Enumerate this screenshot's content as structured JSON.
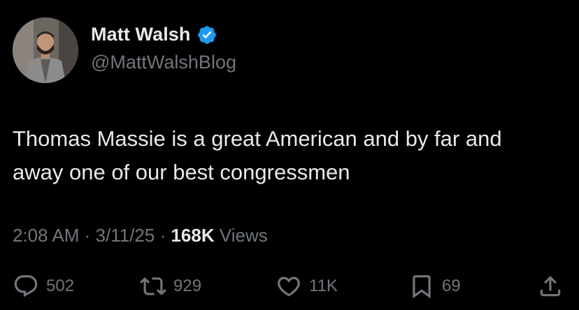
{
  "author": {
    "display_name": "Matt Walsh",
    "handle": "@MattWalshBlog",
    "verified_color": "#1d9bf0"
  },
  "tweet": {
    "text": "Thomas Massie is a great American and by far and away one of our best congressmen",
    "time": "2:08 AM",
    "separator_1": " · ",
    "date": "3/11/25",
    "separator_2": " · ",
    "views_count": "168K",
    "views_label": " Views"
  },
  "actions": {
    "replies": "502",
    "reposts": "929",
    "likes": "11K",
    "bookmarks": "69"
  },
  "icons": [
    "reply-icon",
    "repost-icon",
    "like-icon",
    "bookmark-icon",
    "share-icon",
    "verified-badge-icon"
  ]
}
